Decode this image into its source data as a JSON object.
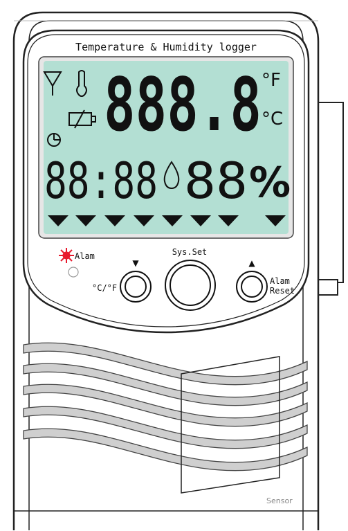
{
  "device": {
    "title": "Temperature & Humidity logger",
    "sensor_label": "Sensor"
  },
  "lcd": {
    "main_digits": "888.8",
    "time_digits": "88:88",
    "humidity_digits": "88",
    "percent_symbol": "%",
    "unit_f": "°F",
    "unit_c": "°C",
    "indicator_count": 8
  },
  "controls": {
    "alarm_label": "Alam",
    "cf_label": "°C/°F",
    "down_arrow": "▼",
    "sysset_label": "Sys.Set",
    "up_arrow": "▲",
    "alarm_reset_line1": "Alam",
    "alarm_reset_line2": "Reset"
  },
  "colors": {
    "lcd_bg": "#b3dfd3",
    "lcd_segment": "#111111",
    "alarm_red": "#e8192c",
    "vent_fill": "#cfcfcf",
    "outline": "#222222"
  }
}
